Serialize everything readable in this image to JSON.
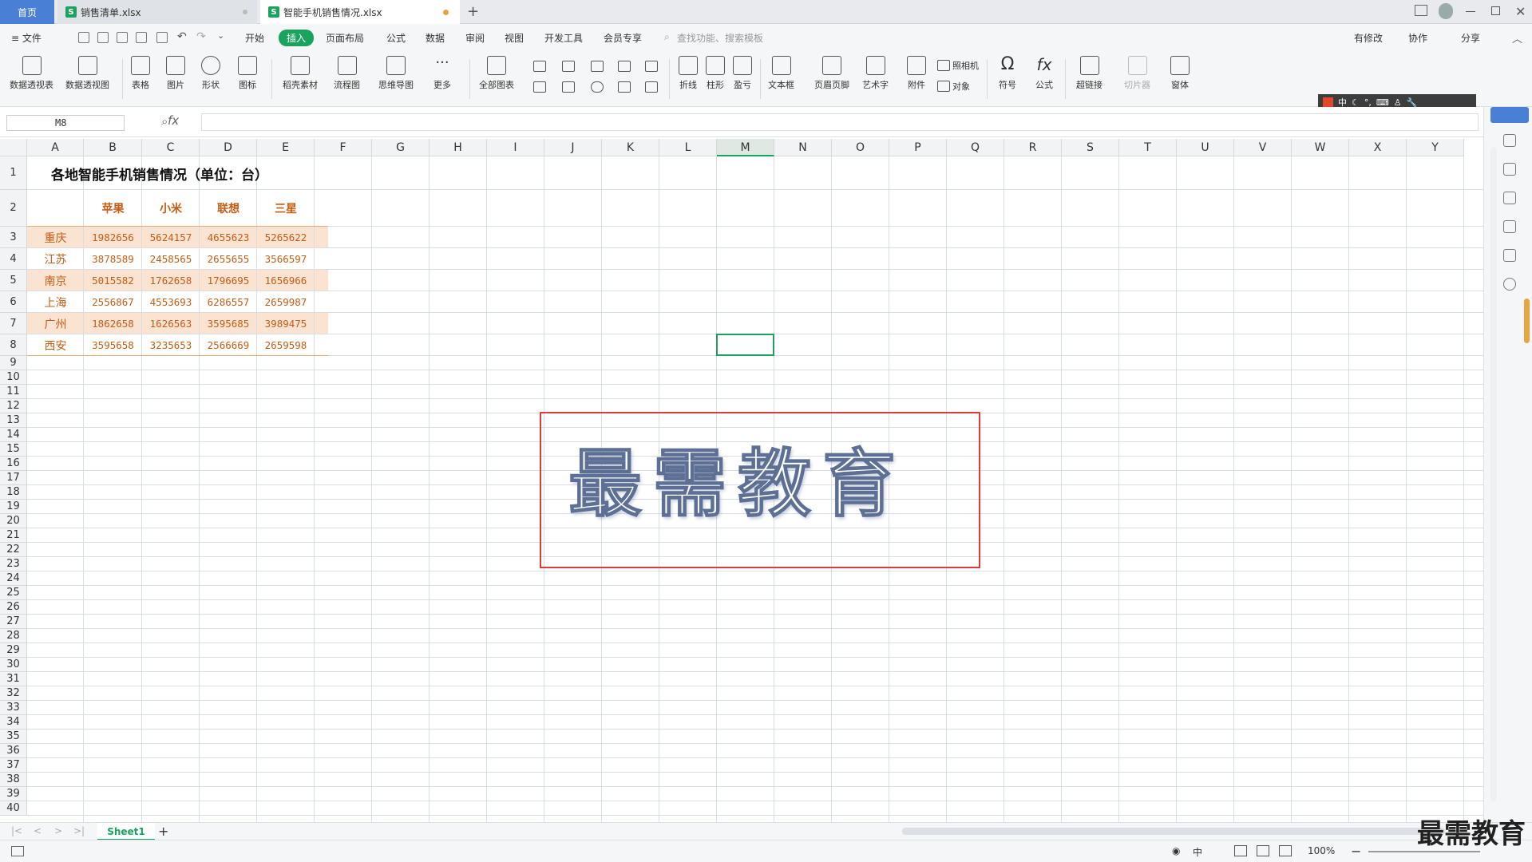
{
  "tabs": {
    "home": "首页",
    "file1": "销售清单.xlsx",
    "file2": "智能手机销售情况.xlsx",
    "new": "+"
  },
  "menu": {
    "file": "≡ 文件",
    "items": [
      "开始",
      "插入",
      "页面布局",
      "公式",
      "数据",
      "审阅",
      "视图",
      "开发工具",
      "会员专享"
    ],
    "active": "插入",
    "search": "查找功能、搜索模板",
    "has_changes": "有修改",
    "collab": "协作",
    "share": "分享"
  },
  "ribbon": {
    "pivot_table": "数据透视表",
    "pivot_view": "数据透视图",
    "table": "表格",
    "picture": "图片",
    "shape": "形状",
    "icon": "图标",
    "material": "稻壳素材",
    "flowchart": "流程图",
    "mindmap": "思维导图",
    "more": "更多",
    "all_charts": "全部图表",
    "line": "折线",
    "column": "柱形",
    "winloss": "盈亏",
    "textbox": "文本框",
    "header_footer": "页眉页脚",
    "wordart": "艺术字",
    "attachment": "附件",
    "camera": "照相机",
    "object": "对象",
    "symbol": "符号",
    "formula": "公式",
    "hyperlink": "超链接",
    "slicer": "切片器",
    "window": "窗体"
  },
  "ime": {
    "label": "中"
  },
  "formula": {
    "cell_ref": "M8",
    "fx": "fx"
  },
  "columns": [
    "A",
    "B",
    "C",
    "D",
    "E",
    "F",
    "G",
    "H",
    "I",
    "J",
    "K",
    "L",
    "M",
    "N",
    "O",
    "P",
    "Q",
    "R",
    "S",
    "T",
    "U",
    "V",
    "W",
    "X",
    "Y"
  ],
  "selected_column": "M",
  "rows": [
    "1",
    "2",
    "3",
    "4",
    "5",
    "6",
    "7",
    "8",
    "9",
    "10",
    "11",
    "12",
    "13",
    "14",
    "15",
    "16",
    "17",
    "18",
    "19",
    "20",
    "21",
    "22",
    "23",
    "24",
    "25",
    "26",
    "27",
    "28",
    "29",
    "30",
    "31",
    "32",
    "33",
    "34",
    "35",
    "36",
    "37",
    "38",
    "39",
    "40"
  ],
  "sheet": {
    "title": "各地智能手机销售情况（单位：台）",
    "headers": [
      "苹果",
      "小米",
      "联想",
      "三星"
    ],
    "data": [
      {
        "city": "重庆",
        "values": [
          "1982656",
          "5624157",
          "4655623",
          "5265622"
        ]
      },
      {
        "city": "江苏",
        "values": [
          "3878589",
          "2458565",
          "2655655",
          "3566597"
        ]
      },
      {
        "city": "南京",
        "values": [
          "5015582",
          "1762658",
          "1796695",
          "1656966"
        ]
      },
      {
        "city": "上海",
        "values": [
          "2556867",
          "4553693",
          "6286557",
          "2659987"
        ]
      },
      {
        "city": "广州",
        "values": [
          "1862658",
          "1626563",
          "3595685",
          "3989475"
        ]
      },
      {
        "city": "西安",
        "values": [
          "3595658",
          "3235653",
          "2566669",
          "2659598"
        ]
      }
    ]
  },
  "wordart_text": "最需教育",
  "sheet_tab": "Sheet1",
  "status": {
    "zoom": "100%"
  },
  "watermark": "最需教育",
  "colors": {
    "accent": "#1aa35f",
    "band": "#fbe3d2",
    "text_orange": "#c65d14",
    "red_box": "#e03a3a"
  }
}
